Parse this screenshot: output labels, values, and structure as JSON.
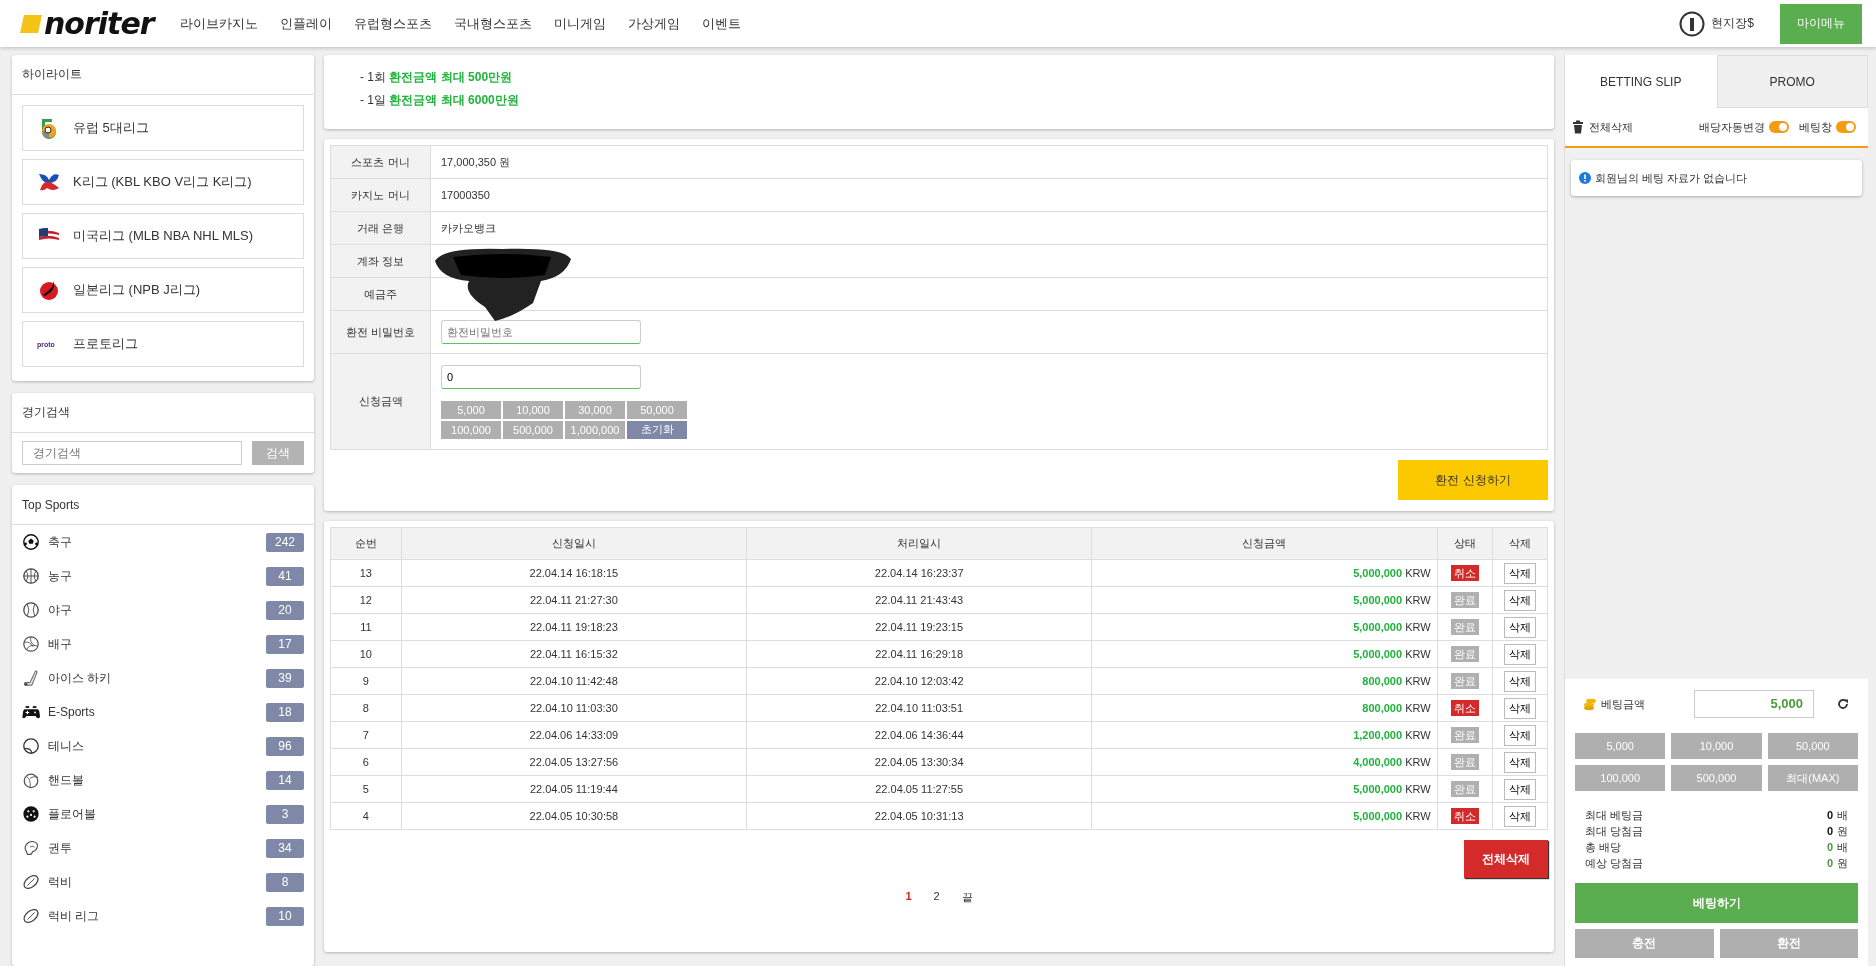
{
  "header": {
    "logo": "noriter",
    "nav": [
      "라이브카지노",
      "인플레이",
      "유럽형스포츠",
      "국내형스포츠",
      "미니게임",
      "가상게임",
      "이벤트"
    ],
    "user": "현지장$",
    "my_menu": "마이메뉴"
  },
  "sidebar": {
    "highlight": {
      "title": "하이라이트",
      "items": [
        {
          "label": "유럽 5대리그",
          "kind": "euro"
        },
        {
          "label": "K리그 (KBL KBO V리그 K리그)",
          "kind": "korea"
        },
        {
          "label": "미국리그 (MLB NBA NHL MLS)",
          "kind": "usa"
        },
        {
          "label": "일본리그 (NPB J리그)",
          "kind": "japan"
        },
        {
          "label": "프로토리그",
          "kind": "proto",
          "logo_text": "proto"
        }
      ]
    },
    "search": {
      "title": "경기검색",
      "placeholder": "경기검색",
      "button": "검색"
    },
    "top_sports": {
      "title": "Top Sports",
      "items": [
        {
          "name": "축구",
          "count": "242",
          "kind": "soccer"
        },
        {
          "name": "농구",
          "count": "41",
          "kind": "basketball"
        },
        {
          "name": "야구",
          "count": "20",
          "kind": "baseball"
        },
        {
          "name": "배구",
          "count": "17",
          "kind": "volleyball"
        },
        {
          "name": "아이스 하키",
          "count": "39",
          "kind": "hockey"
        },
        {
          "name": "E-Sports",
          "count": "18",
          "kind": "esports"
        },
        {
          "name": "테니스",
          "count": "96",
          "kind": "tennis"
        },
        {
          "name": "핸드볼",
          "count": "14",
          "kind": "handball"
        },
        {
          "name": "플로어볼",
          "count": "3",
          "kind": "floorball"
        },
        {
          "name": "권투",
          "count": "34",
          "kind": "boxing"
        },
        {
          "name": "럭비",
          "count": "8",
          "kind": "rugby"
        },
        {
          "name": "럭비 리그",
          "count": "10",
          "kind": "rugby"
        }
      ]
    }
  },
  "notice": [
    {
      "prefix": "- 1회",
      "text": "환전금액 최대 500만원"
    },
    {
      "prefix": "- 1일",
      "text": "환전금액 최대 6000만원"
    }
  ],
  "form": {
    "rows": [
      {
        "label": "스포츠 머니",
        "value": "17,000,350 원"
      },
      {
        "label": "카지노 머니",
        "value": "17000350"
      },
      {
        "label": "거래 은행",
        "value": "카카오뱅크"
      },
      {
        "label": "계좌 정보"
      },
      {
        "label": "예금주"
      }
    ],
    "password": {
      "label": "환전 비밀번호",
      "placeholder": "환전비밀번호"
    },
    "amount": {
      "label": "신청금액",
      "value": "0",
      "chips": [
        "5,000",
        "10,000",
        "30,000",
        "50,000",
        "100,000",
        "500,000",
        "1,000,000"
      ],
      "reset": "초기화"
    },
    "submit": "환전 신청하기"
  },
  "history": {
    "columns": [
      "순번",
      "신청일시",
      "처리일시",
      "신청금액",
      "상태",
      "삭제"
    ],
    "rows": [
      {
        "no": "13",
        "requested": "22.04.14 16:18:15",
        "processed": "22.04.14 16:23:37",
        "amount": "5,000,000",
        "currency": "KRW",
        "status": "취소",
        "cancelled": true,
        "delete": "삭제"
      },
      {
        "no": "12",
        "requested": "22.04.11 21:27:30",
        "processed": "22.04.11 21:43:43",
        "amount": "5,000,000",
        "currency": "KRW",
        "status": "완료",
        "cancelled": false,
        "delete": "삭제"
      },
      {
        "no": "11",
        "requested": "22.04.11 19:18:23",
        "processed": "22.04.11 19:23:15",
        "amount": "5,000,000",
        "currency": "KRW",
        "status": "완료",
        "cancelled": false,
        "delete": "삭제"
      },
      {
        "no": "10",
        "requested": "22.04.11 16:15:32",
        "processed": "22.04.11 16:29:18",
        "amount": "5,000,000",
        "currency": "KRW",
        "status": "완료",
        "cancelled": false,
        "delete": "삭제"
      },
      {
        "no": "9",
        "requested": "22.04.10 11:42:48",
        "processed": "22.04.10 12:03:42",
        "amount": "800,000",
        "currency": "KRW",
        "status": "완료",
        "cancelled": false,
        "delete": "삭제"
      },
      {
        "no": "8",
        "requested": "22.04.10 11:03:30",
        "processed": "22.04.10 11:03:51",
        "amount": "800,000",
        "currency": "KRW",
        "status": "취소",
        "cancelled": true,
        "delete": "삭제"
      },
      {
        "no": "7",
        "requested": "22.04.06 14:33:09",
        "processed": "22.04.06 14:36:44",
        "amount": "1,200,000",
        "currency": "KRW",
        "status": "완료",
        "cancelled": false,
        "delete": "삭제"
      },
      {
        "no": "6",
        "requested": "22.04.05 13:27:56",
        "processed": "22.04.05 13:30:34",
        "amount": "4,000,000",
        "currency": "KRW",
        "status": "완료",
        "cancelled": false,
        "delete": "삭제"
      },
      {
        "no": "5",
        "requested": "22.04.05 11:19:44",
        "processed": "22.04.05 11:27:55",
        "amount": "5,000,000",
        "currency": "KRW",
        "status": "완료",
        "cancelled": false,
        "delete": "삭제"
      },
      {
        "no": "4",
        "requested": "22.04.05 10:30:58",
        "processed": "22.04.05 10:31:13",
        "amount": "5,000,000",
        "currency": "KRW",
        "status": "취소",
        "cancelled": true,
        "delete": "삭제"
      }
    ],
    "delete_all": "전체삭제",
    "pages": [
      {
        "label": "1",
        "selected": true
      },
      {
        "label": "2",
        "selected": false
      },
      {
        "label": "끝",
        "selected": false
      }
    ]
  },
  "betslip": {
    "tabs": [
      {
        "label": "BETTING SLIP",
        "selected": true
      },
      {
        "label": "PROMO",
        "selected": false
      }
    ],
    "clear": "전체삭제",
    "toggles": [
      {
        "label": "배당자동변경",
        "on": true
      },
      {
        "label": "베팅창",
        "on": true
      }
    ],
    "empty_message": "회원님의 베팅 자료가 없습니다",
    "amount_label": "베팅금액",
    "amount": "5,000",
    "chips": [
      "5,000",
      "10,000",
      "50,000",
      "100,000",
      "500,000",
      "최대(MAX)"
    ],
    "stats": [
      {
        "label": "최대 베팅금",
        "value": "0",
        "unit": "배",
        "highlight": false
      },
      {
        "label": "최대 당첨금",
        "value": "0",
        "unit": "원",
        "highlight": false
      },
      {
        "label": "총 배당",
        "value": "0",
        "unit": "배",
        "highlight": true
      },
      {
        "label": "예상 당첨금",
        "value": "0",
        "unit": "원",
        "highlight": true
      }
    ],
    "bet_button": "베팅하기",
    "deposit_button": "충전",
    "withdraw_button": "환전"
  }
}
